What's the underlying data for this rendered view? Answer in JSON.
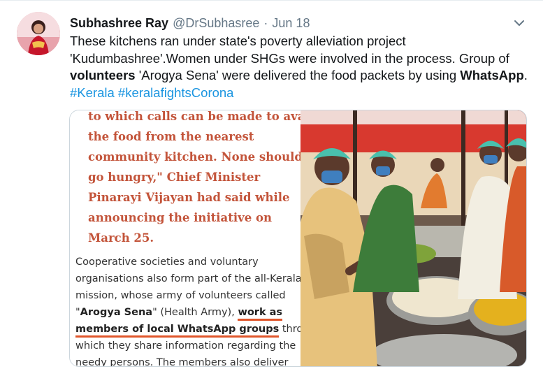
{
  "tweet": {
    "author_name": "Subhashree Ray",
    "handle": "@DrSubhasree",
    "separator": "·",
    "date": "Jun 18",
    "text_part1": "These kitchens ran under state's poverty alleviation project 'Kudumbashree'.Women under SHGs were involved in the process. Group of ",
    "text_bold1": "volunteers",
    "text_part2": " 'Arogya Sena' were delivered the food packets by using ",
    "text_bold2": "WhatsApp",
    "text_part3": ". ",
    "hashtag1": "#Kerala",
    "hashtag_sep": " ",
    "hashtag2": "#keralafightsCorona",
    "link_color": "#1b95e0"
  },
  "media": {
    "quote_lines": [
      "to which calls can be made to avail",
      "the food from the nearest",
      "community kitchen. None should",
      "go hungry,\" Chief Minister",
      "Pinarayi Vijayan had said while",
      "announcing the initiative on",
      "March 25."
    ],
    "body": {
      "line1": "Cooperative societies and voluntary",
      "line2": "organisations also form part of the all-Kerala",
      "line3": "mission, whose army of volunteers called",
      "line4_q1": "\"",
      "line4_b1": "Arogya Sena",
      "line4_q2": "\"",
      "line4_mid": " (Health Army), ",
      "line4_b2": "work as",
      "line5_b": "members of local WhatsApp groups",
      "line5_rest": " through",
      "line6": "which they share information regarding the",
      "line7": "needy persons. The members also deliver"
    },
    "quote_color": "#c3543a",
    "underline_color": "#e0552a"
  },
  "icons": {
    "caret": "chevron-down-icon",
    "avatar": "avatar"
  }
}
